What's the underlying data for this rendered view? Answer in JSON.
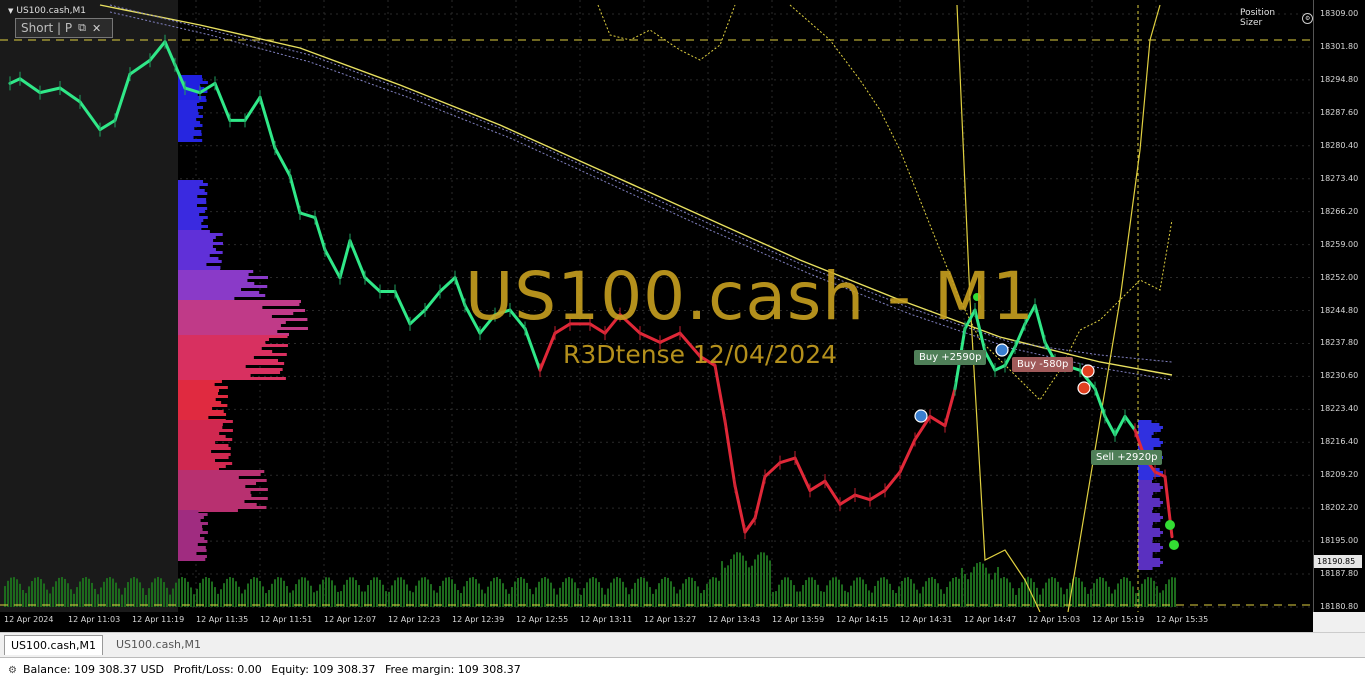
{
  "window": {
    "symbol_title": "US100.cash,M1",
    "trade_panel": {
      "mode_label": "Short | P",
      "restore_icon": "restore-icon",
      "close_icon": "close-icon"
    },
    "position_sizer_label": "Position Sizer",
    "watermark_main": "US100.cash - M1",
    "watermark_sub": "R3Dtense 12/04/2024"
  },
  "trade_tags": [
    {
      "label": "Buy +2590p",
      "color": "#4f7f58"
    },
    {
      "label": "Buy -580p",
      "color": "#a05a5a"
    },
    {
      "label": "Sell +2920p",
      "color": "#4f7f58"
    }
  ],
  "chart_data": {
    "type": "candlestick",
    "symbol": "US100.cash",
    "timeframe": "M1",
    "current_price": "18190.85",
    "price_ticks": [
      "18309.00",
      "18301.80",
      "18294.80",
      "18287.60",
      "18280.40",
      "18273.40",
      "18266.20",
      "18259.00",
      "18252.00",
      "18244.80",
      "18237.80",
      "18230.60",
      "18223.40",
      "18216.40",
      "18209.20",
      "18202.20",
      "18195.00",
      "18187.80",
      "18180.80"
    ],
    "time_ticks": [
      "12 Apr 2024",
      "12 Apr 11:03",
      "12 Apr 11:19",
      "12 Apr 11:35",
      "12 Apr 11:51",
      "12 Apr 12:07",
      "12 Apr 12:23",
      "12 Apr 12:39",
      "12 Apr 12:55",
      "12 Apr 13:11",
      "12 Apr 13:27",
      "12 Apr 13:43",
      "12 Apr 13:59",
      "12 Apr 14:15",
      "12 Apr 14:31",
      "12 Apr 14:47",
      "12 Apr 15:03",
      "12 Apr 15:19",
      "12 Apr 15:35"
    ],
    "ylim": [
      18180.8,
      18309.0
    ],
    "price_path": [
      [
        10,
        18294
      ],
      [
        20,
        18295
      ],
      [
        40,
        18292
      ],
      [
        60,
        18293
      ],
      [
        80,
        18290
      ],
      [
        100,
        18284
      ],
      [
        115,
        18286
      ],
      [
        130,
        18296
      ],
      [
        150,
        18299
      ],
      [
        165,
        18303
      ],
      [
        175,
        18298
      ],
      [
        185,
        18293
      ],
      [
        200,
        18292
      ],
      [
        215,
        18294
      ],
      [
        230,
        18286
      ],
      [
        245,
        18286
      ],
      [
        260,
        18291
      ],
      [
        275,
        18280
      ],
      [
        290,
        18274
      ],
      [
        300,
        18266
      ],
      [
        315,
        18265
      ],
      [
        325,
        18258
      ],
      [
        340,
        18252
      ],
      [
        350,
        18260
      ],
      [
        365,
        18252
      ],
      [
        380,
        18249
      ],
      [
        395,
        18249
      ],
      [
        410,
        18242
      ],
      [
        425,
        18245
      ],
      [
        440,
        18249
      ],
      [
        455,
        18252
      ],
      [
        465,
        18246
      ],
      [
        480,
        18240
      ],
      [
        495,
        18244
      ],
      [
        510,
        18245
      ],
      [
        525,
        18241
      ],
      [
        540,
        18232
      ],
      [
        555,
        18240
      ],
      [
        570,
        18242
      ],
      [
        590,
        18242
      ],
      [
        605,
        18240
      ],
      [
        620,
        18244
      ],
      [
        640,
        18240
      ],
      [
        660,
        18238
      ],
      [
        680,
        18240
      ],
      [
        700,
        18235
      ],
      [
        715,
        18233
      ],
      [
        725,
        18221
      ],
      [
        735,
        18207
      ],
      [
        745,
        18197
      ],
      [
        755,
        18200
      ],
      [
        765,
        18209
      ],
      [
        780,
        18212
      ],
      [
        795,
        18213
      ],
      [
        810,
        18206
      ],
      [
        825,
        18208
      ],
      [
        840,
        18203
      ],
      [
        855,
        18205
      ],
      [
        870,
        18204
      ],
      [
        885,
        18206
      ],
      [
        900,
        18210
      ],
      [
        915,
        18217
      ],
      [
        930,
        18222
      ],
      [
        945,
        18220
      ],
      [
        955,
        18228
      ],
      [
        965,
        18241
      ],
      [
        975,
        18245
      ],
      [
        985,
        18236
      ],
      [
        995,
        18232
      ],
      [
        1005,
        18233
      ],
      [
        1015,
        18237
      ],
      [
        1025,
        18242
      ],
      [
        1035,
        18246
      ],
      [
        1045,
        18238
      ],
      [
        1055,
        18234
      ],
      [
        1065,
        18233
      ],
      [
        1080,
        18232
      ],
      [
        1095,
        18228
      ],
      [
        1105,
        18222
      ],
      [
        1115,
        18218
      ],
      [
        1125,
        18222
      ],
      [
        1135,
        18219
      ],
      [
        1145,
        18213
      ],
      [
        1155,
        18210
      ],
      [
        1165,
        18209
      ],
      [
        1172,
        18196
      ]
    ]
  },
  "tabs": [
    {
      "label": "US100.cash,M1"
    },
    {
      "label": "US100.cash,M1"
    }
  ],
  "status": {
    "balance": "Balance: 109 308.37 USD",
    "profit_loss": "Profit/Loss: 0.00",
    "equity": "Equity: 109 308.37",
    "free_margin": "Free margin: 109 308.37"
  }
}
